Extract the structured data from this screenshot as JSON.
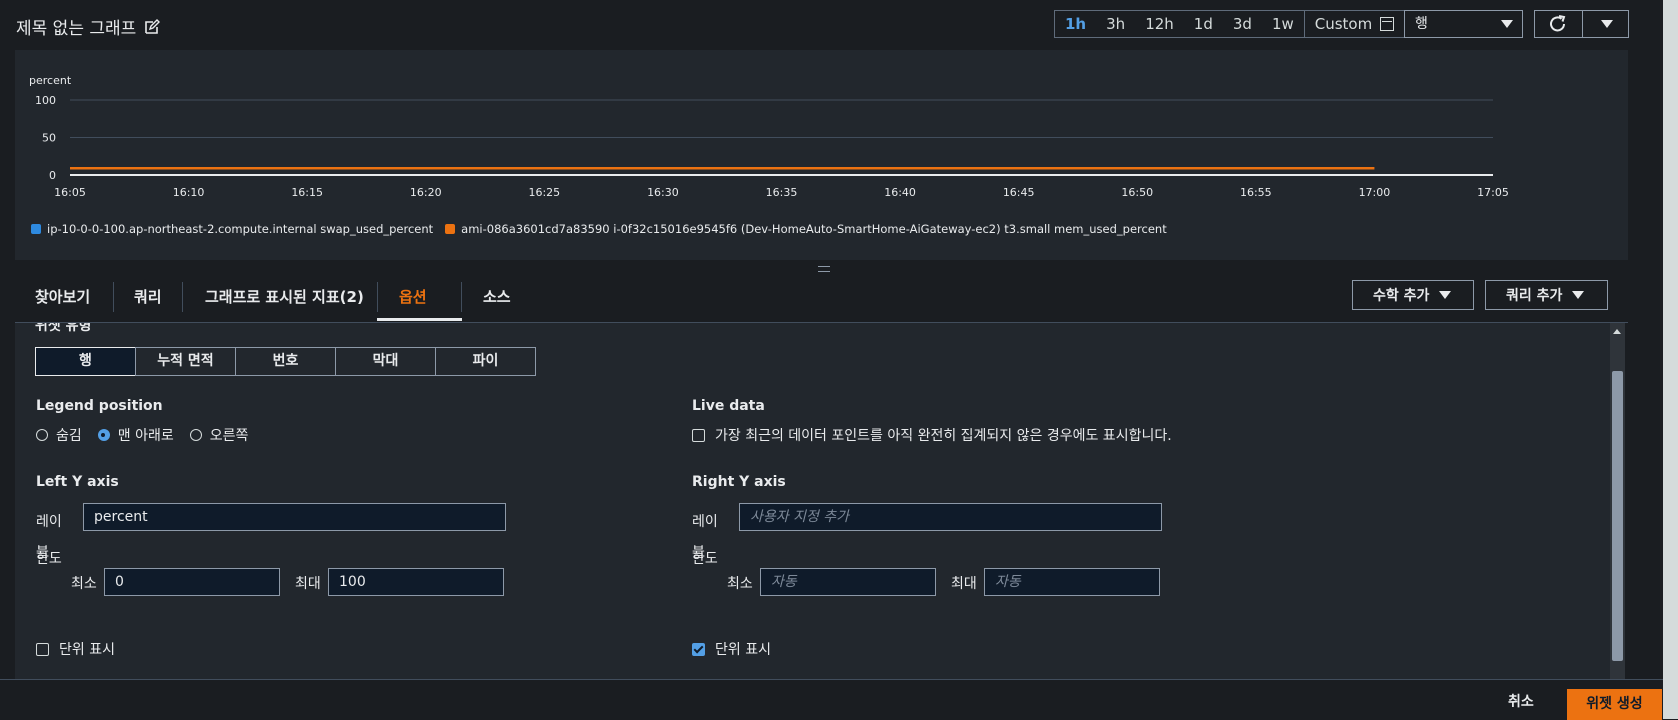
{
  "header": {
    "title": "제목 없는 그래프",
    "time_ranges": [
      "1h",
      "3h",
      "12h",
      "1d",
      "3d",
      "1w"
    ],
    "active_range": "1h",
    "custom_label": "Custom",
    "view_select": "행"
  },
  "chart_data": {
    "type": "line",
    "ylabel": "percent",
    "ylim": [
      0,
      100
    ],
    "y_ticks": [
      "0",
      "50",
      "100"
    ],
    "x_ticks": [
      "16:05",
      "16:10",
      "16:15",
      "16:20",
      "16:25",
      "16:30",
      "16:35",
      "16:40",
      "16:45",
      "16:50",
      "16:55",
      "17:00",
      "17:05"
    ],
    "grid": true,
    "legend_position": "bottom",
    "series": [
      {
        "name": "ip-10-0-0-100.ap-northeast-2.compute.internal swap_used_percent",
        "color": "#2e8ae0",
        "x": [
          "16:05",
          "17:05"
        ],
        "values": [
          0,
          0
        ]
      },
      {
        "name": "ami-086a3601cd7a83590 i-0f32c15016e9545f6 (Dev-HomeAuto-SmartHome-AiGateway-ec2) t3.small mem_used_percent",
        "color": "#ec7211",
        "x": [
          "16:05",
          "17:00"
        ],
        "values": [
          9,
          9
        ]
      }
    ]
  },
  "tabs": {
    "items": [
      "찾아보기",
      "쿼리",
      "그래프로 표시된 지표(2)",
      "옵션",
      "소스"
    ],
    "active": "옵션",
    "math_button": "수학 추가",
    "query_button": "쿼리 추가"
  },
  "options": {
    "widget_type_title": "위젯 유형",
    "widget_types": [
      "행",
      "누적 면적",
      "번호",
      "막대",
      "파이"
    ],
    "widget_type_selected": "행",
    "legend": {
      "title": "Legend position",
      "choices": [
        "숨김",
        "맨 아래로",
        "오른쪽"
      ],
      "selected": "맨 아래로"
    },
    "live_data": {
      "title": "Live data",
      "checkbox_label": "가장 최근의 데이터 포인트를 아직 완전히 집계되지 않은 경우에도 표시합니다.",
      "checked": false
    },
    "left_axis": {
      "title": "Left Y axis",
      "label_caption": "레이블",
      "label_value": "percent",
      "limits_caption": "한도",
      "min_caption": "최소",
      "min_value": "0",
      "max_caption": "최대",
      "max_value": "100",
      "units_label": "단위 표시",
      "units_checked": false
    },
    "right_axis": {
      "title": "Right Y axis",
      "label_caption": "레이블",
      "label_placeholder": "사용자 지정 추가",
      "limits_caption": "한도",
      "min_caption": "최소",
      "min_placeholder": "자동",
      "max_caption": "최대",
      "max_placeholder": "자동",
      "units_label": "단위 표시",
      "units_checked": true
    }
  },
  "footer": {
    "cancel": "취소",
    "create": "위젯 생성"
  }
}
